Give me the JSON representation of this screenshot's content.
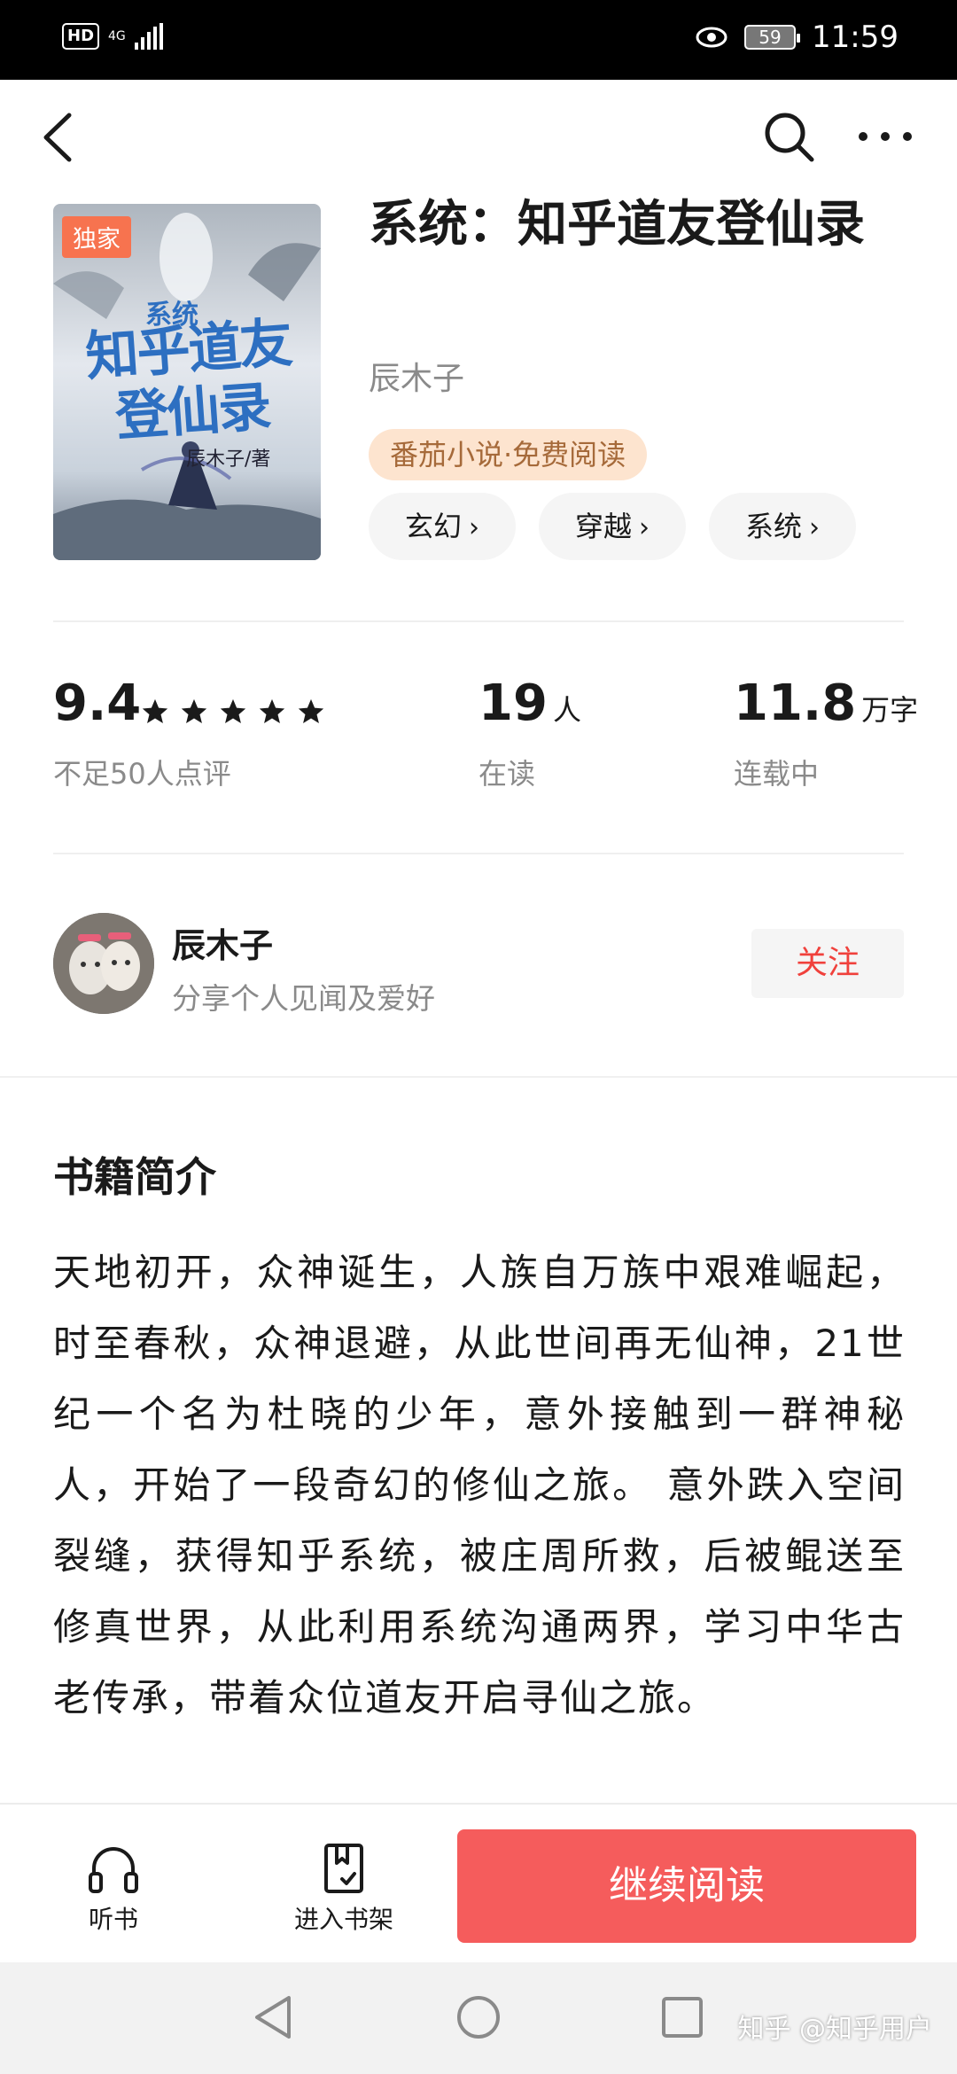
{
  "status_bar": {
    "hd": "HD",
    "network": "4G",
    "battery": "59",
    "time": "11:59"
  },
  "book": {
    "exclusive_badge": "独家",
    "cover_series": "系统",
    "cover_title": "知乎道友登仙录",
    "cover_author": "辰木子/著",
    "title": "系统：知乎道友登仙录",
    "author": "辰木子",
    "source_tag": "番茄小说·免费阅读",
    "genres": [
      "玄幻",
      "穿越",
      "系统"
    ]
  },
  "stats": {
    "rating": "9.4",
    "rating_stars": 5,
    "rating_note": "不足50人点评",
    "readers": "19",
    "readers_unit": "人",
    "readers_label": "在读",
    "words": "11.8",
    "words_unit": "万字",
    "status_label": "连载中"
  },
  "author_card": {
    "name": "辰木子",
    "bio": "分享个人见闻及爱好",
    "follow_label": "关注"
  },
  "intro": {
    "heading": "书籍简介",
    "text": "天地初开，众神诞生，人族自万族中艰难崛起，时至春秋，众神退避，从此世间再无仙神，21世纪一个名为杜晓的少年，意外接触到一群神秘人，开始了一段奇幻的修仙之旅。 意外跌入空间裂缝，获得知乎系统，被庄周所救，后被鲲送至修真世界，从此利用系统沟通两界，学习中华古老传承，带着众位道友开启寻仙之旅。"
  },
  "bottom_bar": {
    "listen_label": "听书",
    "shelf_label": "进入书架",
    "continue_label": "继续阅读"
  },
  "watermark": "知乎 @知乎用户",
  "colors": {
    "accent_red": "#f55c5c",
    "follow_red": "#f0413c",
    "badge_orange": "#f7734f",
    "source_tag_bg": "#fde4cf"
  }
}
